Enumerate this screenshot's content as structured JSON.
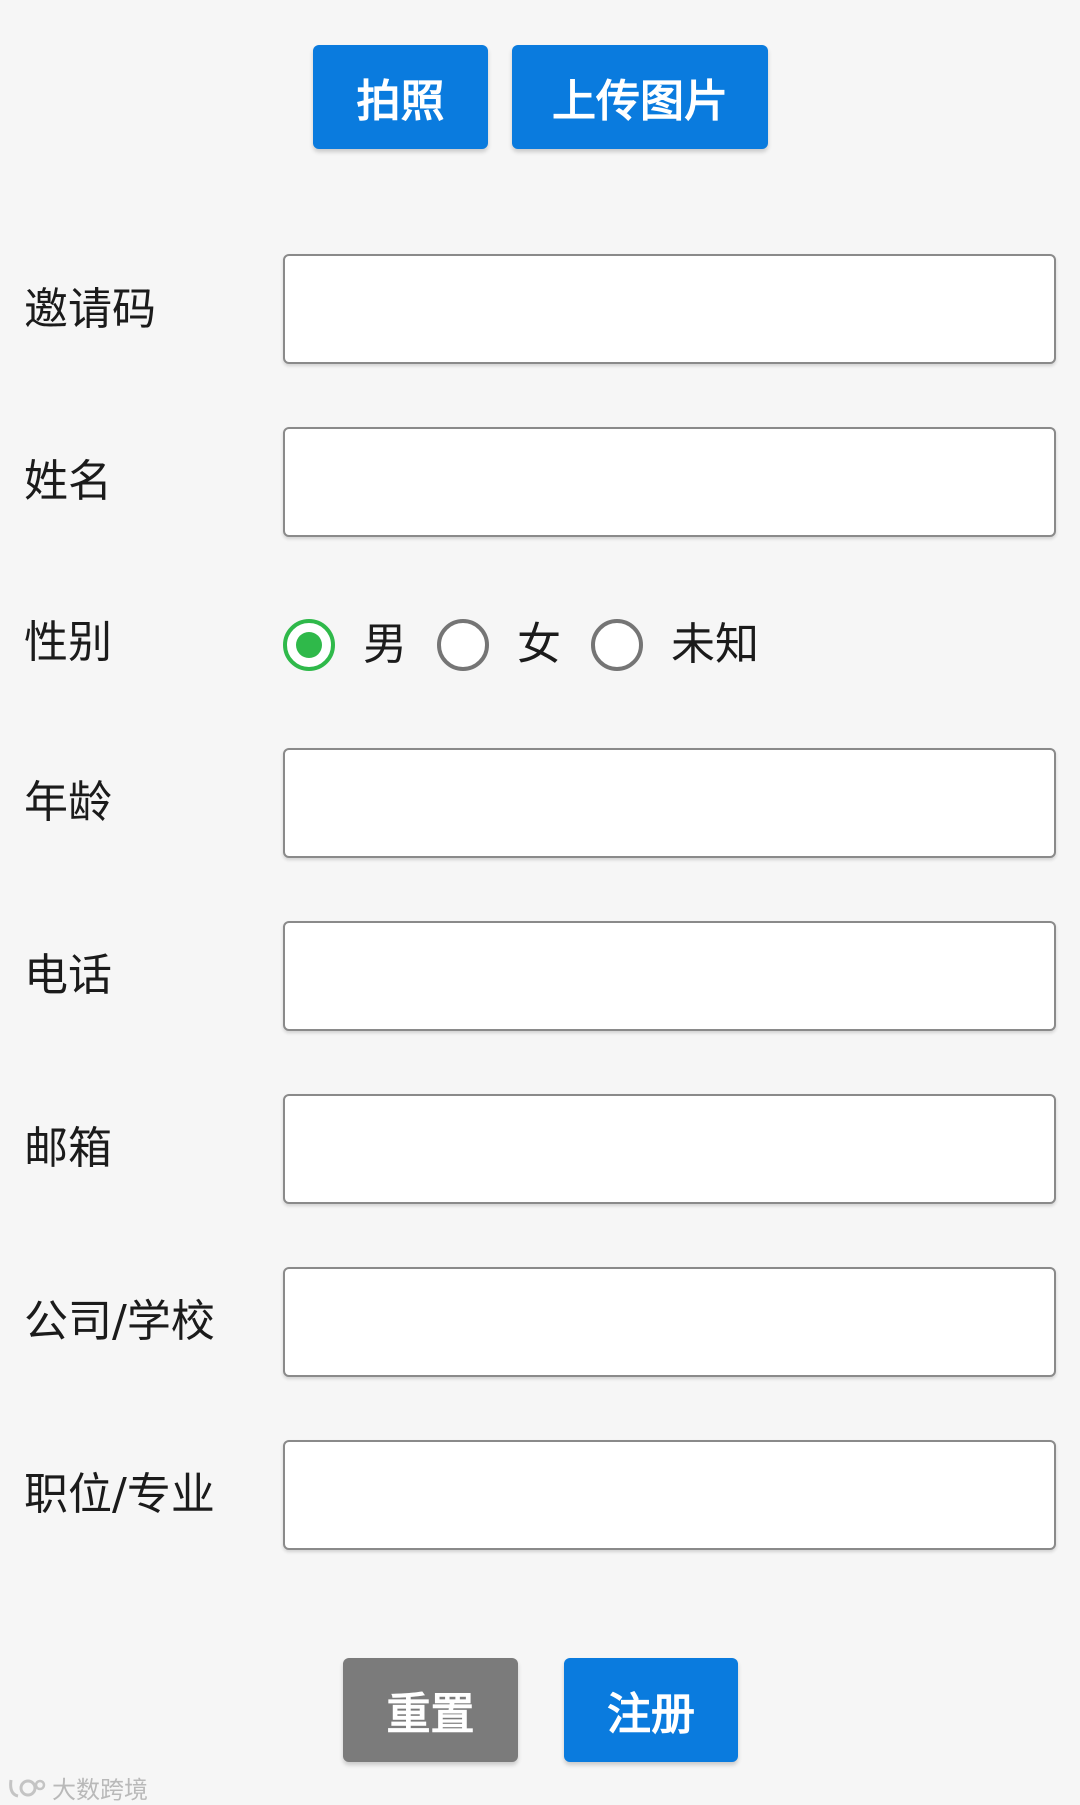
{
  "toolbar": {
    "photo_label": "拍照",
    "upload_label": "上传图片"
  },
  "form": {
    "invite_code": {
      "label": "邀请码",
      "value": ""
    },
    "name": {
      "label": "姓名",
      "value": ""
    },
    "gender": {
      "label": "性别",
      "options": [
        "男",
        "女",
        "未知"
      ],
      "selected": "男"
    },
    "age": {
      "label": "年龄",
      "value": ""
    },
    "phone": {
      "label": "电话",
      "value": ""
    },
    "email": {
      "label": "邮箱",
      "value": ""
    },
    "company": {
      "label": "公司/学校",
      "value": ""
    },
    "position": {
      "label": "职位/专业",
      "value": ""
    }
  },
  "actions": {
    "reset_label": "重置",
    "register_label": "注册"
  },
  "watermark": {
    "text": "大数跨境"
  },
  "colors": {
    "primary": "#0a7bde",
    "secondary": "#7b7b7b",
    "radio_checked": "#2fb94a"
  }
}
